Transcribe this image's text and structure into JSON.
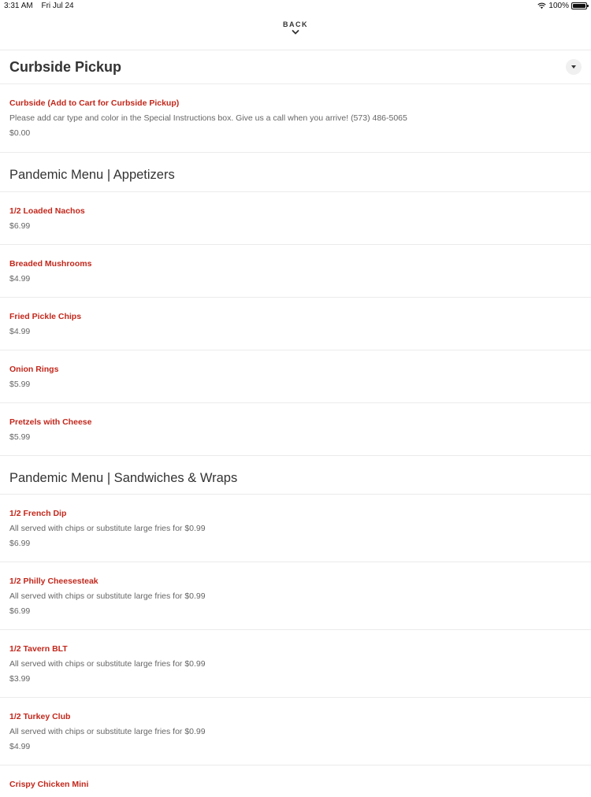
{
  "status_bar": {
    "time": "3:31 AM",
    "date": "Fri Jul 24",
    "battery": "100%",
    "battery_level": 1.0,
    "icons": [
      "wifi-icon",
      "battery-icon"
    ]
  },
  "nav": {
    "back_label": "BACK",
    "back_icon": "chevron-down-icon"
  },
  "colors": {
    "item_name": "#c2271b",
    "text": "#333333",
    "muted": "#666666",
    "divider": "#ebebeb"
  },
  "sections": [
    {
      "title": "Curbside Pickup",
      "collapse_icon": "caret-down-icon",
      "items": [
        {
          "name": "Curbside (Add to Cart for Curbside Pickup)",
          "description": "Please add car type and color in the Special Instructions box. Give us a call when you arrive! (573) 486-5065",
          "price": "$0.00"
        }
      ]
    },
    {
      "title": "Pandemic Menu | Appetizers",
      "items": [
        {
          "name": "1/2 Loaded Nachos",
          "price": "$6.99"
        },
        {
          "name": "Breaded Mushrooms",
          "price": "$4.99"
        },
        {
          "name": "Fried Pickle Chips",
          "price": "$4.99"
        },
        {
          "name": "Onion Rings",
          "price": "$5.99"
        },
        {
          "name": "Pretzels with Cheese",
          "price": "$5.99"
        }
      ]
    },
    {
      "title": "Pandemic Menu | Sandwiches & Wraps",
      "items": [
        {
          "name": "1/2 French Dip",
          "description": "All served with chips or substitute large fries for $0.99",
          "price": "$6.99"
        },
        {
          "name": "1/2 Philly Cheesesteak",
          "description": "All served with chips or substitute large fries for $0.99",
          "price": "$6.99"
        },
        {
          "name": "1/2 Tavern BLT",
          "description": "All served with chips or substitute large fries for $0.99",
          "price": "$3.99"
        },
        {
          "name": "1/2 Turkey Club",
          "description": "All served with chips or substitute large fries for $0.99",
          "price": "$4.99"
        },
        {
          "name": "Crispy Chicken Mini"
        }
      ]
    }
  ]
}
